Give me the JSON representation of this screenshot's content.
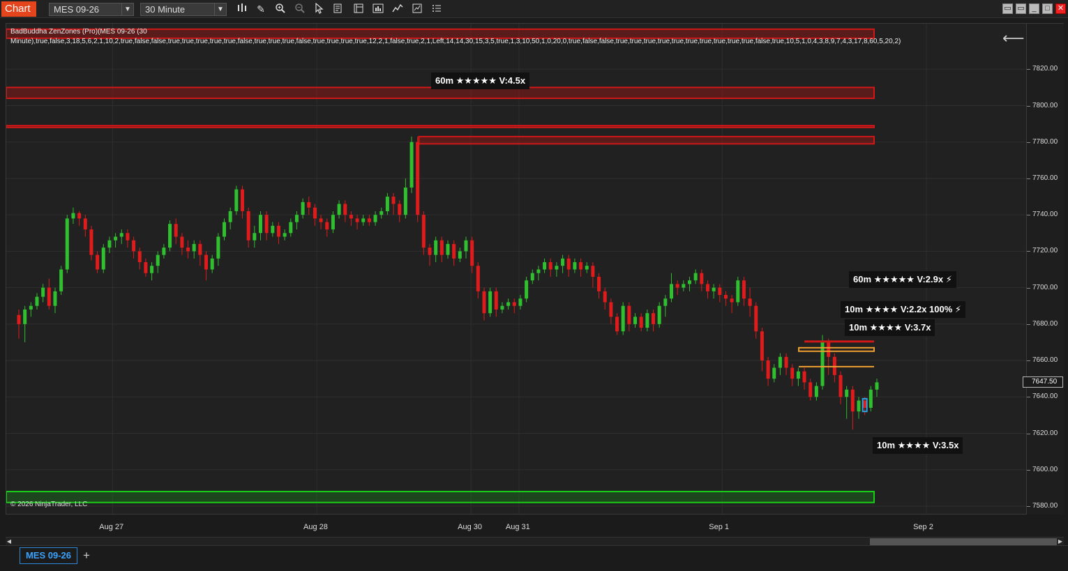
{
  "toolbar": {
    "chart_tag": "Chart",
    "instrument": "MES 09-26",
    "interval": "30 Minute",
    "icons": [
      "bar-type-icon",
      "drawing-pencil-icon",
      "zoom-in-icon",
      "zoom-out-icon",
      "cursor-icon",
      "data-box-icon",
      "properties-icon",
      "strategies-icon",
      "indicators-icon",
      "templates-icon",
      "menu-list-icon"
    ],
    "window_icons": [
      "minimize-icon",
      "restore-icon",
      "maximize-icon",
      "close-icon"
    ]
  },
  "indicator": {
    "label_line1": "BadBuddha ZenZones (Pro)(MES 09-26 (30",
    "label_line2": "Minute),true,false,3,18,5,6,2,1,10,2,true,false,false,true,true,true,true,true,false,true,true,true,false,true,true,true,true,12,2,1,false,true,2,1,Left,14,14,30,15,3,5,true,1,3,10,50,1,0,20,0,true,false,false,true,true,true,true,true,true,true,true,true,true,false,true,10,5,1,0,4,3,8,9,7,4,3,17,8,60,5,20,2)"
  },
  "zone_labels": [
    {
      "text": "60m ★★★★★ V:4.5x",
      "price": 7818
    },
    {
      "text": "60m ★★★★★ V:2.9x ⚡",
      "price": 7702
    },
    {
      "text": "10m ★★★★ V:2.2x 100% ⚡",
      "price": 7685
    },
    {
      "text": "10m ★★★★ V:3.7x",
      "price": 7675
    },
    {
      "text": "10m ★★★★ V:3.5x",
      "price": 7609
    }
  ],
  "price_axis": {
    "ticks": [
      "7820.00",
      "7800.00",
      "7780.00",
      "7760.00",
      "7740.00",
      "7720.00",
      "7700.00",
      "7680.00",
      "7660.00",
      "7640.00",
      "7620.00",
      "7600.00",
      "7580.00"
    ],
    "current_price": "7647.50",
    "min": 7575,
    "max": 7845
  },
  "time_axis": {
    "ticks": [
      {
        "label": "Aug 27",
        "pos": 0.104
      },
      {
        "label": "Aug 28",
        "pos": 0.304
      },
      {
        "label": "Aug 30",
        "pos": 0.455
      },
      {
        "label": "Aug 31",
        "pos": 0.502
      },
      {
        "label": "Sep 1",
        "pos": 0.701
      },
      {
        "label": "Sep 2",
        "pos": 0.901
      }
    ]
  },
  "copyright": "© 2026 NinjaTrader, LLC",
  "colors": {
    "bull": "#2fbf2f",
    "bear": "#e01b1b",
    "supply_zone": "#d01818",
    "demand_zone": "#19d019",
    "orange_zone": "#f0a030",
    "cyan_box": "#29a6e0",
    "grid": "#2f2f2f"
  },
  "zones": [
    {
      "type": "supply",
      "top": 7842,
      "bottom": 7837,
      "start": 0.0
    },
    {
      "type": "supply",
      "top": 7810,
      "bottom": 7804,
      "start": 0.0
    },
    {
      "type": "supply-line",
      "top": 7789,
      "bottom": 7788,
      "start": 0.0
    },
    {
      "type": "supply",
      "top": 7783,
      "bottom": 7779,
      "start": 0.404
    },
    {
      "type": "demand",
      "top": 7588,
      "bottom": 7582,
      "start": 0.0
    }
  ],
  "tabs": {
    "active": "MES 09-26",
    "add": "+"
  },
  "chart_data": {
    "type": "candlestick",
    "instrument": "MES 09-26",
    "interval": "30 Minute",
    "ylim": [
      7575,
      7845
    ],
    "candles": [
      [
        7685,
        7680,
        7688,
        7672
      ],
      [
        7680,
        7688,
        7690,
        7670
      ],
      [
        7688,
        7690,
        7692,
        7684
      ],
      [
        7690,
        7695,
        7697,
        7688
      ],
      [
        7695,
        7700,
        7702,
        7692
      ],
      [
        7700,
        7690,
        7705,
        7688
      ],
      [
        7690,
        7698,
        7700,
        7686
      ],
      [
        7698,
        7710,
        7712,
        7696
      ],
      [
        7710,
        7738,
        7740,
        7708
      ],
      [
        7738,
        7741,
        7744,
        7735
      ],
      [
        7741,
        7738,
        7742,
        7734
      ],
      [
        7738,
        7732,
        7740,
        7728
      ],
      [
        7732,
        7718,
        7734,
        7715
      ],
      [
        7718,
        7710,
        7720,
        7708
      ],
      [
        7710,
        7722,
        7724,
        7708
      ],
      [
        7722,
        7726,
        7728,
        7719
      ],
      [
        7726,
        7728,
        7730,
        7722
      ],
      [
        7728,
        7730,
        7732,
        7724
      ],
      [
        7730,
        7726,
        7732,
        7722
      ],
      [
        7726,
        7720,
        7728,
        7716
      ],
      [
        7720,
        7714,
        7722,
        7710
      ],
      [
        7714,
        7708,
        7716,
        7706
      ],
      [
        7708,
        7712,
        7714,
        7704
      ],
      [
        7712,
        7718,
        7720,
        7708
      ],
      [
        7718,
        7722,
        7724,
        7716
      ],
      [
        7722,
        7735,
        7737,
        7720
      ],
      [
        7735,
        7728,
        7738,
        7724
      ],
      [
        7728,
        7722,
        7730,
        7718
      ],
      [
        7722,
        7720,
        7726,
        7716
      ],
      [
        7720,
        7724,
        7726,
        7716
      ],
      [
        7724,
        7718,
        7726,
        7712
      ],
      [
        7718,
        7710,
        7720,
        7704
      ],
      [
        7710,
        7716,
        7718,
        7708
      ],
      [
        7716,
        7728,
        7730,
        7712
      ],
      [
        7728,
        7736,
        7738,
        7726
      ],
      [
        7736,
        7742,
        7744,
        7732
      ],
      [
        7742,
        7754,
        7756,
        7740
      ],
      [
        7754,
        7742,
        7756,
        7738
      ],
      [
        7742,
        7726,
        7744,
        7722
      ],
      [
        7726,
        7730,
        7734,
        7722
      ],
      [
        7730,
        7740,
        7742,
        7726
      ],
      [
        7740,
        7730,
        7742,
        7726
      ],
      [
        7730,
        7734,
        7736,
        7728
      ],
      [
        7734,
        7728,
        7736,
        7724
      ],
      [
        7728,
        7730,
        7732,
        7726
      ],
      [
        7730,
        7736,
        7738,
        7728
      ],
      [
        7736,
        7740,
        7742,
        7732
      ],
      [
        7740,
        7747,
        7749,
        7738
      ],
      [
        7747,
        7744,
        7750,
        7740
      ],
      [
        7744,
        7738,
        7746,
        7734
      ],
      [
        7738,
        7736,
        7740,
        7732
      ],
      [
        7736,
        7732,
        7738,
        7728
      ],
      [
        7732,
        7740,
        7742,
        7730
      ],
      [
        7740,
        7746,
        7748,
        7738
      ],
      [
        7746,
        7740,
        7748,
        7736
      ],
      [
        7740,
        7738,
        7742,
        7734
      ],
      [
        7738,
        7736,
        7740,
        7732
      ],
      [
        7736,
        7738,
        7740,
        7734
      ],
      [
        7738,
        7736,
        7740,
        7734
      ],
      [
        7736,
        7740,
        7742,
        7734
      ],
      [
        7740,
        7742,
        7744,
        7738
      ],
      [
        7742,
        7750,
        7752,
        7740
      ],
      [
        7750,
        7746,
        7752,
        7740
      ],
      [
        7746,
        7740,
        7748,
        7736
      ],
      [
        7740,
        7755,
        7760,
        7738
      ],
      [
        7755,
        7780,
        7783,
        7752
      ],
      [
        7780,
        7740,
        7783,
        7736
      ],
      [
        7740,
        7722,
        7742,
        7718
      ],
      [
        7722,
        7718,
        7724,
        7712
      ],
      [
        7718,
        7726,
        7728,
        7714
      ],
      [
        7726,
        7718,
        7728,
        7714
      ],
      [
        7718,
        7724,
        7726,
        7716
      ],
      [
        7724,
        7716,
        7726,
        7712
      ],
      [
        7716,
        7720,
        7722,
        7714
      ],
      [
        7720,
        7726,
        7728,
        7716
      ],
      [
        7726,
        7712,
        7728,
        7708
      ],
      [
        7712,
        7698,
        7714,
        7694
      ],
      [
        7698,
        7686,
        7700,
        7682
      ],
      [
        7686,
        7698,
        7700,
        7684
      ],
      [
        7698,
        7688,
        7700,
        7684
      ],
      [
        7688,
        7690,
        7692,
        7686
      ],
      [
        7690,
        7692,
        7694,
        7688
      ],
      [
        7692,
        7690,
        7694,
        7686
      ],
      [
        7690,
        7694,
        7696,
        7688
      ],
      [
        7694,
        7704,
        7706,
        7692
      ],
      [
        7704,
        7708,
        7710,
        7702
      ],
      [
        7708,
        7710,
        7712,
        7704
      ],
      [
        7710,
        7714,
        7716,
        7708
      ],
      [
        7714,
        7710,
        7716,
        7706
      ],
      [
        7710,
        7712,
        7714,
        7706
      ],
      [
        7712,
        7716,
        7718,
        7708
      ],
      [
        7716,
        7710,
        7718,
        7706
      ],
      [
        7710,
        7714,
        7716,
        7708
      ],
      [
        7714,
        7710,
        7716,
        7706
      ],
      [
        7710,
        7712,
        7714,
        7708
      ],
      [
        7712,
        7706,
        7714,
        7700
      ],
      [
        7706,
        7698,
        7708,
        7694
      ],
      [
        7698,
        7692,
        7700,
        7688
      ],
      [
        7692,
        7684,
        7694,
        7680
      ],
      [
        7684,
        7676,
        7686,
        7674
      ],
      [
        7676,
        7690,
        7692,
        7674
      ],
      [
        7690,
        7680,
        7692,
        7676
      ],
      [
        7680,
        7684,
        7686,
        7678
      ],
      [
        7684,
        7678,
        7686,
        7676
      ],
      [
        7678,
        7686,
        7688,
        7676
      ],
      [
        7686,
        7680,
        7688,
        7676
      ],
      [
        7680,
        7690,
        7692,
        7678
      ],
      [
        7690,
        7694,
        7696,
        7684
      ],
      [
        7694,
        7702,
        7708,
        7692
      ],
      [
        7702,
        7700,
        7704,
        7696
      ],
      [
        7700,
        7702,
        7704,
        7698
      ],
      [
        7702,
        7704,
        7706,
        7698
      ],
      [
        7704,
        7708,
        7710,
        7702
      ],
      [
        7708,
        7702,
        7710,
        7698
      ],
      [
        7702,
        7698,
        7704,
        7694
      ],
      [
        7698,
        7700,
        7702,
        7694
      ],
      [
        7700,
        7696,
        7702,
        7692
      ],
      [
        7696,
        7694,
        7698,
        7690
      ],
      [
        7694,
        7692,
        7696,
        7686
      ],
      [
        7692,
        7704,
        7706,
        7690
      ],
      [
        7704,
        7694,
        7706,
        7690
      ],
      [
        7694,
        7690,
        7700,
        7684
      ],
      [
        7690,
        7676,
        7692,
        7672
      ],
      [
        7676,
        7660,
        7678,
        7654
      ],
      [
        7660,
        7650,
        7662,
        7646
      ],
      [
        7650,
        7656,
        7658,
        7648
      ],
      [
        7656,
        7662,
        7664,
        7652
      ],
      [
        7662,
        7656,
        7664,
        7652
      ],
      [
        7656,
        7650,
        7658,
        7646
      ],
      [
        7650,
        7654,
        7656,
        7646
      ],
      [
        7654,
        7648,
        7656,
        7644
      ],
      [
        7648,
        7640,
        7650,
        7638
      ],
      [
        7640,
        7646,
        7648,
        7638
      ],
      [
        7646,
        7670,
        7674,
        7644
      ],
      [
        7670,
        7662,
        7672,
        7652
      ],
      [
        7662,
        7652,
        7664,
        7648
      ],
      [
        7652,
        7640,
        7654,
        7636
      ],
      [
        7640,
        7644,
        7646,
        7628
      ],
      [
        7644,
        7632,
        7646,
        7622
      ],
      [
        7632,
        7638,
        7640,
        7628
      ],
      [
        7638,
        7634,
        7640,
        7630
      ],
      [
        7634,
        7644,
        7646,
        7632
      ],
      [
        7644,
        7648,
        7650,
        7640
      ]
    ]
  }
}
